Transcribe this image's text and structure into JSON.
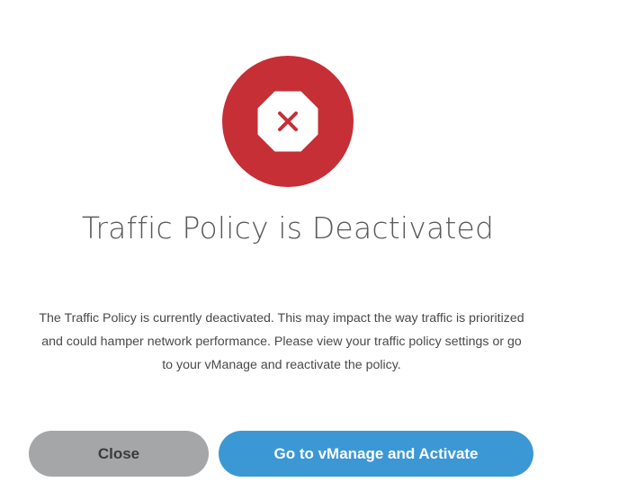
{
  "dialog": {
    "status_icon": "octagon-x-icon",
    "title": "Traffic Policy is Deactivated",
    "message_lines": [
      "The Traffic Policy is currently deactivated. This may impact the way traffic is prioritized",
      "and could hamper network performance. Please view your traffic policy settings or go",
      "to your vManage and reactivate the policy."
    ],
    "buttons": {
      "close_label": "Close",
      "activate_label": "Go to vManage and Activate"
    }
  },
  "colors": {
    "error_red": "#c62f36",
    "primary_blue": "#3b98d4",
    "secondary_gray": "#a5a6a8",
    "title_gray": "#58595b"
  }
}
